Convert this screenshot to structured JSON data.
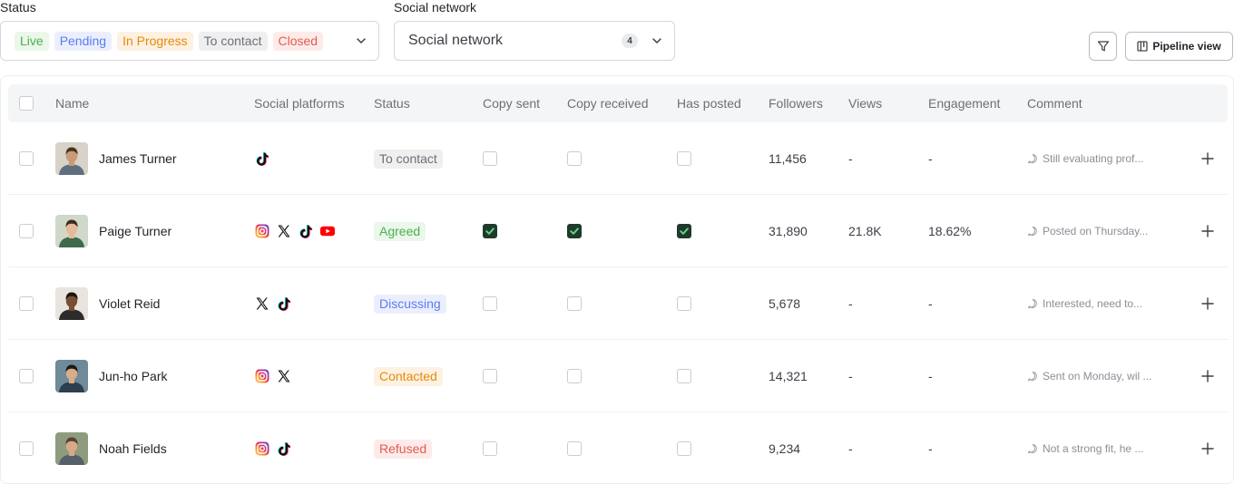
{
  "filters": {
    "status_label": "Status",
    "status_chips": [
      {
        "label": "Live",
        "color": "#4caf50",
        "bg": "#eaf7ea"
      },
      {
        "label": "Pending",
        "color": "#5b7cf0",
        "bg": "#ebeffd"
      },
      {
        "label": "In Progress",
        "color": "#e8890c",
        "bg": "#fdf1e2"
      },
      {
        "label": "To contact",
        "color": "#6b7078",
        "bg": "#efeff0"
      },
      {
        "label": "Closed",
        "color": "#e55b4e",
        "bg": "#fdebea"
      }
    ],
    "social_label": "Social network",
    "social_placeholder": "Social network",
    "social_count": "4"
  },
  "toolbar": {
    "pipeline_label": "Pipeline view"
  },
  "table": {
    "headers": {
      "name": "Name",
      "platforms": "Social platforms",
      "status": "Status",
      "copy_sent": "Copy sent",
      "copy_received": "Copy received",
      "has_posted": "Has posted",
      "followers": "Followers",
      "views": "Views",
      "engagement": "Engagement",
      "comment": "Comment"
    },
    "rows": [
      {
        "name": "James Turner",
        "platforms": [
          "tiktok-icon"
        ],
        "status": "To contact",
        "status_color": "#6b7078",
        "status_bg": "#efeff0",
        "copy_sent": false,
        "copy_received": false,
        "has_posted": false,
        "followers": "11,456",
        "views": "-",
        "engagement": "-",
        "comment": "Still evaluating prof...",
        "avatar": {
          "skin": "#c99a78",
          "hair": "#4a3324",
          "shirt": "#5f6f80",
          "bg": "#d8d2c8"
        }
      },
      {
        "name": "Paige Turner",
        "platforms": [
          "instagram-icon",
          "x-icon",
          "tiktok-icon",
          "youtube-icon"
        ],
        "status": "Agreed",
        "status_color": "#4caf50",
        "status_bg": "#eaf7ea",
        "copy_sent": true,
        "copy_received": true,
        "has_posted": true,
        "followers": "31,890",
        "views": "21.8K",
        "engagement": "18.62%",
        "comment": "Posted on Thursday...",
        "avatar": {
          "skin": "#e5b99a",
          "hair": "#3d2a1f",
          "shirt": "#3f6a4a",
          "bg": "#cfd8c9"
        }
      },
      {
        "name": "Violet Reid",
        "platforms": [
          "x-icon",
          "tiktok-icon"
        ],
        "status": "Discussing",
        "status_color": "#5b7cf0",
        "status_bg": "#ebeffd",
        "copy_sent": false,
        "copy_received": false,
        "has_posted": false,
        "followers": "5,678",
        "views": "-",
        "engagement": "-",
        "comment": "Interested, need to...",
        "avatar": {
          "skin": "#7a4e34",
          "hair": "#1d1410",
          "shirt": "#2c2c2c",
          "bg": "#e8e4de"
        }
      },
      {
        "name": "Jun-ho Park",
        "platforms": [
          "instagram-icon",
          "x-icon"
        ],
        "status": "Contacted",
        "status_color": "#e8890c",
        "status_bg": "#fdf1e2",
        "copy_sent": false,
        "copy_received": false,
        "has_posted": false,
        "followers": "14,321",
        "views": "-",
        "engagement": "-",
        "comment": "Sent on Monday, wil ...",
        "avatar": {
          "skin": "#d9ac88",
          "hair": "#1a1a1a",
          "shirt": "#2d3e50",
          "bg": "#6f8a99"
        }
      },
      {
        "name": "Noah Fields",
        "platforms": [
          "instagram-icon",
          "tiktok-icon"
        ],
        "status": "Refused",
        "status_color": "#e55b4e",
        "status_bg": "#fdebea",
        "copy_sent": false,
        "copy_received": false,
        "has_posted": false,
        "followers": "9,234",
        "views": "-",
        "engagement": "-",
        "comment": "Not a strong fit, he ...",
        "avatar": {
          "skin": "#d6a988",
          "hair": "#5a4030",
          "shirt": "#55606a",
          "bg": "#8f9b7e"
        }
      }
    ]
  }
}
